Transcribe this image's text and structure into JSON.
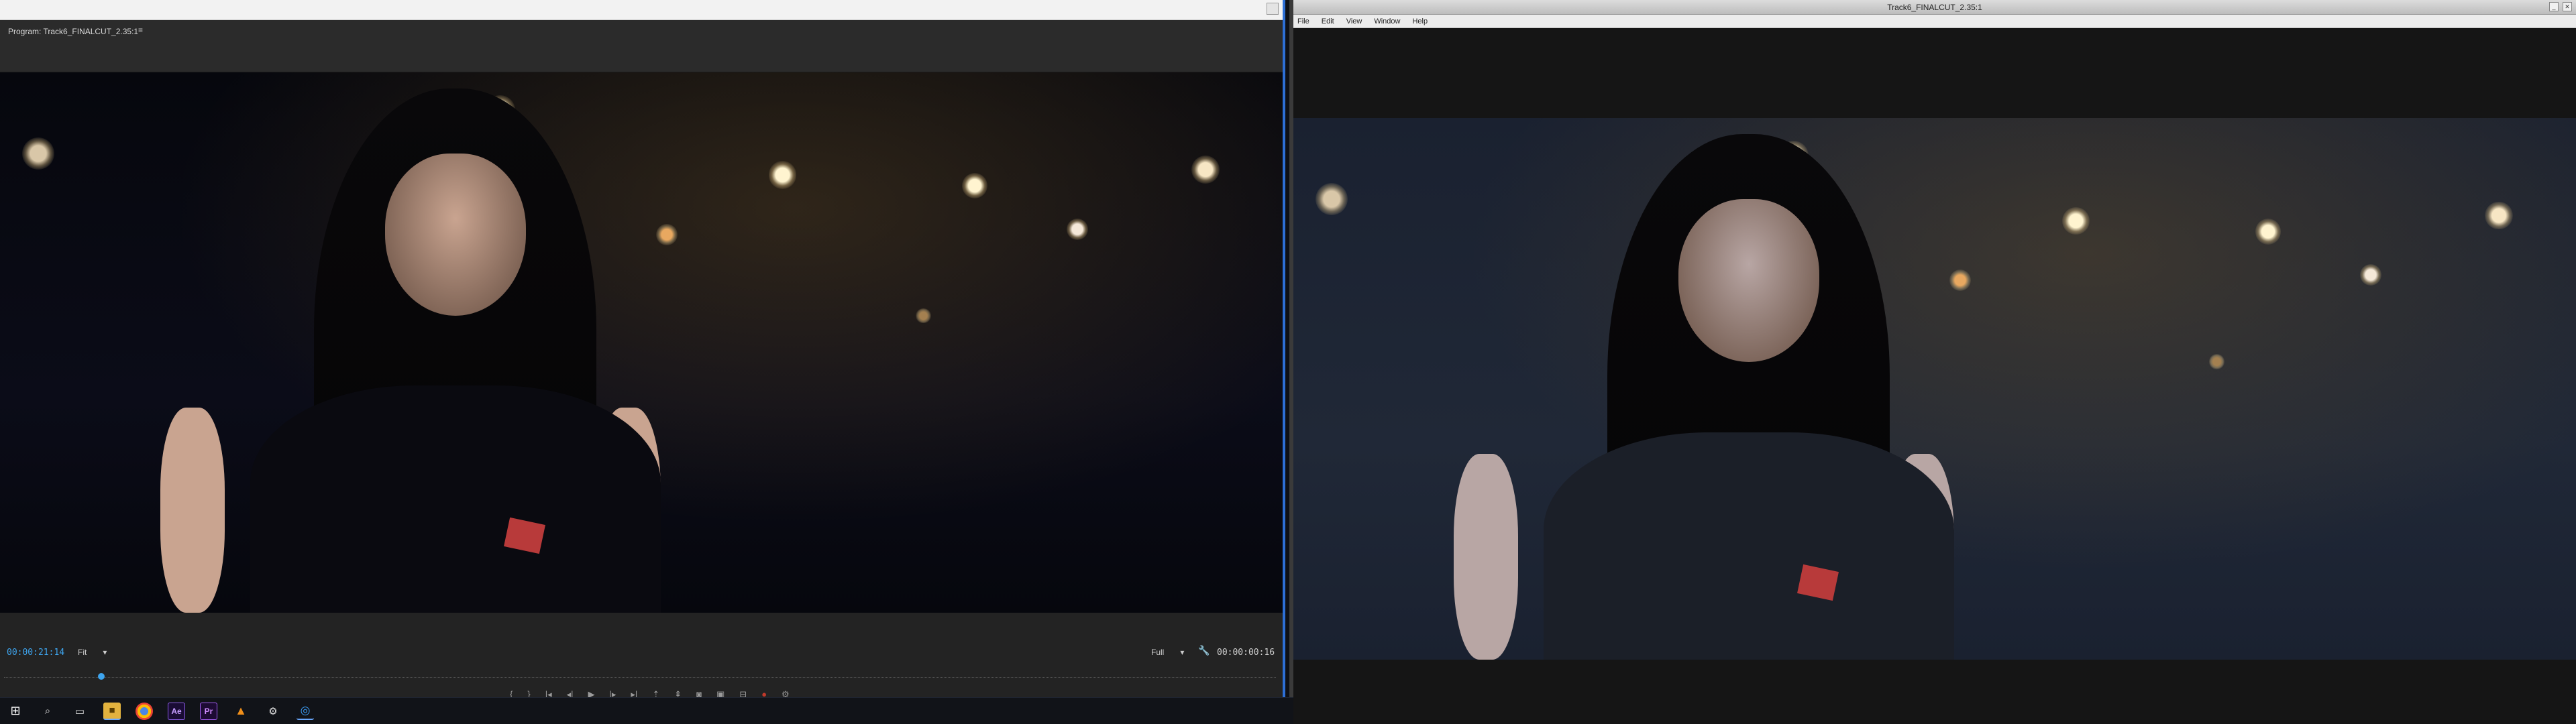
{
  "left_monitor": {
    "panel_tab": "Program: Track6_FINALCUT_2.35:1",
    "panel_menu_icon": "≡",
    "timecode_current": "00:00:21:14",
    "fit_value": "Fit",
    "quality_value": "Full",
    "timecode_duration": "00:00:00:16",
    "playhead_fraction": 0.074,
    "grade": {
      "bg_top": "#06070d",
      "bg_mid": "#0b0c18",
      "skin": "#c9a490",
      "dress": "#0a0a10"
    }
  },
  "right_monitor": {
    "window_title": "Track6_FINALCUT_2.35:1",
    "menu": [
      "File",
      "Edit",
      "View",
      "Window",
      "Help"
    ],
    "grade": {
      "bg_top": "#1a2130",
      "bg_mid": "#202837",
      "skin": "#b8a6a4",
      "dress": "#1b1f28"
    }
  },
  "icons": {
    "chevron": "▾",
    "wrench": "🔧",
    "windows_start": "⊞",
    "search": "⌕",
    "task_view": "▭",
    "folder": "■",
    "vlc": "▲",
    "blue_app": "◎"
  },
  "taskbar": {
    "apps": [
      "windows-start",
      "search",
      "task-view",
      "file-explorer",
      "chrome",
      "after-effects",
      "premiere-pro",
      "vlc",
      "steam",
      "blue-app"
    ],
    "labels": {
      "ae": "Ae",
      "pr": "Pr"
    }
  },
  "accent": "#3ea5ef"
}
